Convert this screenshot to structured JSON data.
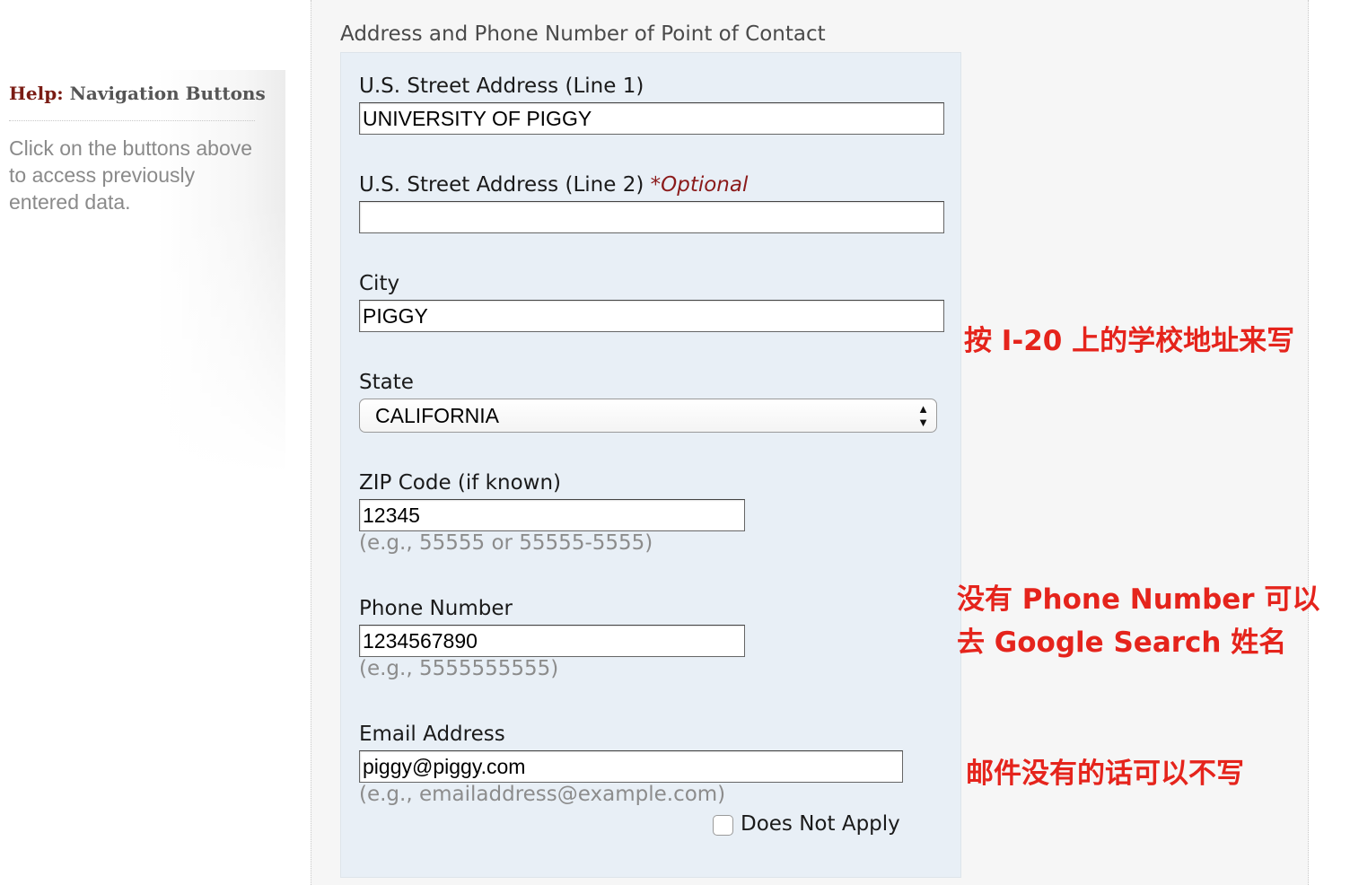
{
  "help": {
    "title_key": "Help:",
    "title_rest": "Navigation Buttons",
    "text": "Click on the buttons above to access previously entered data."
  },
  "form": {
    "section_title": "Address and Phone Number of Point of Contact",
    "street1": {
      "label": "U.S. Street Address (Line 1)",
      "value": "UNIVERSITY OF PIGGY"
    },
    "street2": {
      "label": "U.S. Street Address (Line 2)",
      "optional": "*Optional",
      "value": ""
    },
    "city": {
      "label": "City",
      "value": "PIGGY"
    },
    "state": {
      "label": "State",
      "value": "CALIFORNIA"
    },
    "zip": {
      "label": "ZIP Code (if known)",
      "value": "12345",
      "hint": "(e.g., 55555 or 55555-5555)"
    },
    "phone": {
      "label": "Phone Number",
      "value": "1234567890",
      "hint": "(e.g., 5555555555)"
    },
    "email": {
      "label": "Email Address",
      "value": "piggy@piggy.com",
      "hint": "(e.g., emailaddress@example.com)"
    },
    "does_not_apply": {
      "label": "Does Not Apply",
      "checked": false
    }
  },
  "annotations": {
    "address_note": "按 I-20 上的学校地址来写",
    "phone_note_line1": "没有 Phone Number 可以",
    "phone_note_line2": "去 Google Search 姓名",
    "email_note": "邮件没有的话可以不写"
  },
  "colors": {
    "annotation_red": "#e5241c",
    "form_background": "#e8eff6",
    "help_title_red": "#7a1c14",
    "optional_red": "#8b1a1a"
  }
}
